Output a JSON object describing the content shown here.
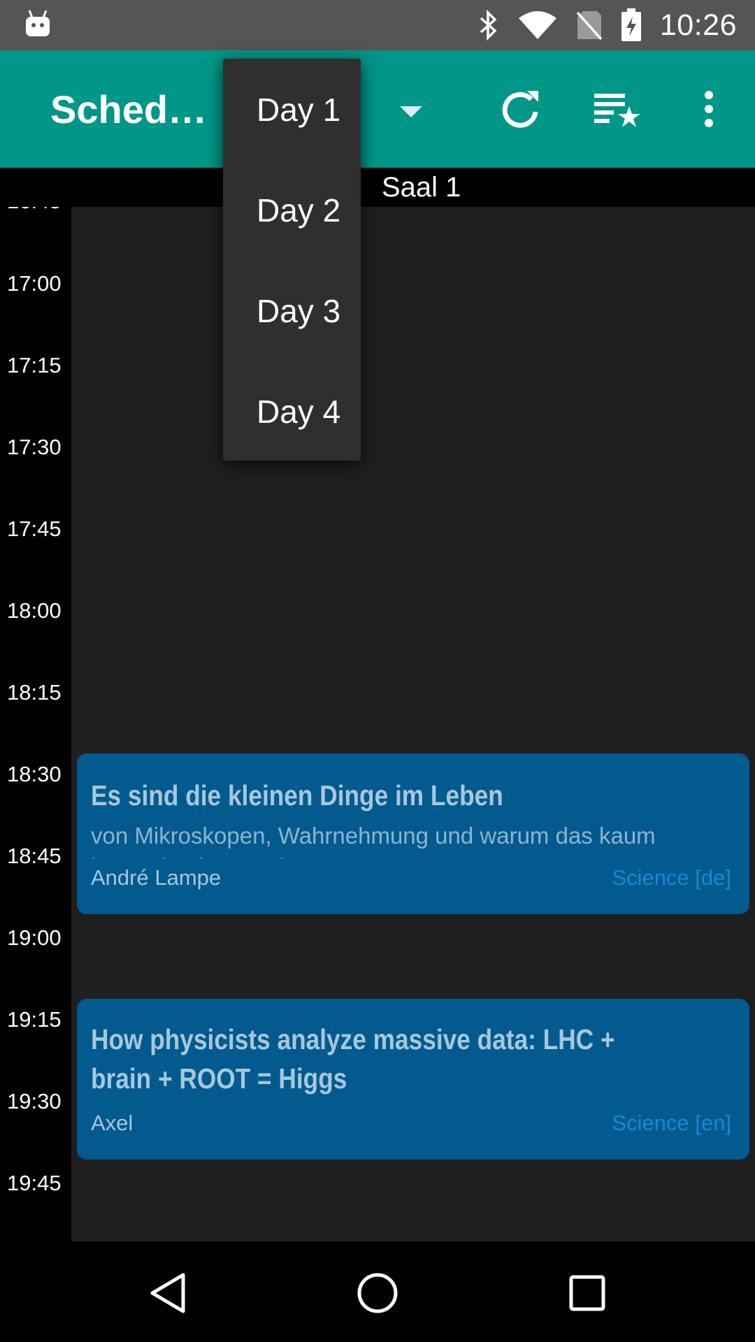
{
  "status_bar": {
    "time": "10:26"
  },
  "app_bar": {
    "title": "Sched…"
  },
  "room_header": {
    "name": "Saal 1"
  },
  "times": [
    "17:00",
    "17:15",
    "17:30",
    "17:45",
    "18:00",
    "18:15",
    "18:30",
    "18:45",
    "19:00",
    "19:15",
    "19:30",
    "19:45"
  ],
  "events": [
    {
      "title": "Es sind die kleinen Dinge im Leben",
      "subtitle": "von Mikroskopen, Wahrnehmung und warum das kaum jemanden interessiert",
      "speaker": "André Lampe",
      "track": "Science [de]"
    },
    {
      "title": "How physicists analyze massive data: LHC + brain + ROOT = Higgs",
      "speaker": "Axel",
      "track": "Science [en]"
    }
  ],
  "day_menu": {
    "items": [
      "Day 1",
      "Day 2",
      "Day 3",
      "Day 4"
    ]
  },
  "colors": {
    "app_bar": "#009688",
    "event_bg": "#025a8f",
    "track_text": "#1a88d1",
    "dropdown_bg": "#2f2f2f"
  }
}
